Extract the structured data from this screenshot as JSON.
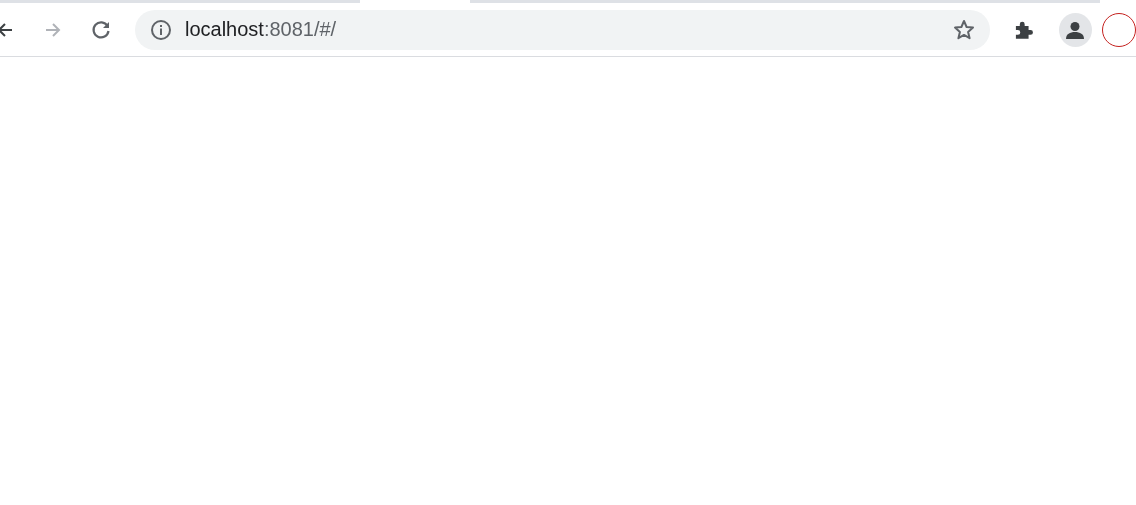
{
  "toolbar": {
    "back": {
      "disabled": false
    },
    "forward": {
      "disabled": true
    },
    "address_bar": {
      "host": "localhost",
      "path": ":8081/#/"
    }
  }
}
